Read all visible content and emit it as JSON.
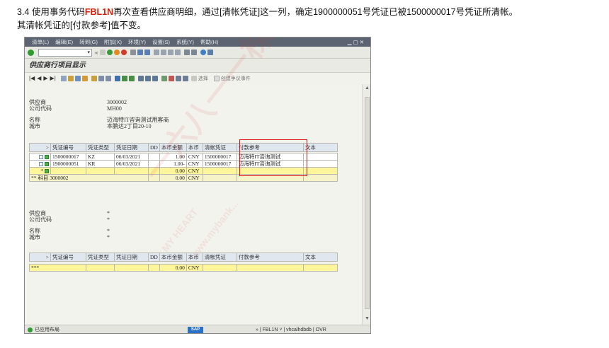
{
  "caption": {
    "line1_prefix": "3.4 使用事务代码",
    "tcode": "FBL1N",
    "line1_suffix": "再次查看供应商明细，通过[清帐凭证]这一列，确定1900000051号凭证已被1500000017号凭证所清帐。",
    "line2": "其清帐凭证的[付款参考]值不变。"
  },
  "menubar": {
    "items": [
      "清单(L)",
      "编辑(E)",
      "转到(G)",
      "附加(X)",
      "环境(Y)",
      "设置(S)",
      "系统(Y)",
      "帮助(H)"
    ]
  },
  "toolbar": {
    "command_value": "",
    "back_arrows": "«"
  },
  "window": {
    "title": "供应商行项目显示"
  },
  "app_toolbar": {
    "select_label": "选择",
    "dispute_label": "创建争议事件"
  },
  "header1": {
    "vendor_label": "供应商",
    "vendor_value": "3000002",
    "company_label": "公司代码",
    "company_value": "MH00",
    "name_label": "名称",
    "name_value": "迈海特IT咨询测试用客商",
    "city_label": "城市",
    "city_value": "本鹏达2丁目20-10"
  },
  "grid1": {
    "columns": [
      ">",
      "凭证编号",
      "凭证类型",
      "凭证日期",
      "DD",
      "本币金额",
      "本币",
      "清帐凭证",
      "付款参考",
      "文本"
    ],
    "rows": [
      {
        "doc": "1500000017",
        "type": "KZ",
        "date": "06/03/2021",
        "dd": "",
        "amount": "1.00",
        "curr": "CNY",
        "clearing": "1500000017",
        "payref": "迈海特IT咨询测试",
        "text": ""
      },
      {
        "doc": "1900000051",
        "type": "KR",
        "date": "06/03/2021",
        "dd": "",
        "amount": "1.00-",
        "curr": "CNY",
        "clearing": "1500000017",
        "payref": "迈海特IT咨询测试",
        "text": ""
      }
    ],
    "total_marker": "*",
    "total_amount": "0.00",
    "total_curr": "CNY",
    "subtotal_label": "** 科目 3000002",
    "subtotal_amount": "0.00",
    "subtotal_curr": "CNY"
  },
  "header2": {
    "vendor_label": "供应商",
    "vendor_value": "*",
    "company_label": "公司代码",
    "company_value": "*",
    "name_label": "名称",
    "name_value": "*",
    "city_label": "城市",
    "city_value": "*"
  },
  "grid2": {
    "columns": [
      ">",
      "凭证编号",
      "凭证类型",
      "凭证日期",
      "DD",
      "本币金额",
      "本币",
      "清帐凭证",
      "付款参考",
      "文本"
    ],
    "total_marker": "***",
    "total_amount": "0.00",
    "total_curr": "CNY"
  },
  "statusbar": {
    "left_text": "已应用布局",
    "logo_text": "SAP",
    "right_text": "» | FBL1N ˅ | vhcalhdbdb | OVR"
  },
  "watermark": {
    "main": "一六八一一株式",
    "sub": "MY HEART",
    "url": "www.mybank..."
  },
  "colors": {
    "menubar": "#5b6470",
    "highlight_row": "#fff59a",
    "red_box": "#e01010",
    "accent": "#d81e06"
  }
}
